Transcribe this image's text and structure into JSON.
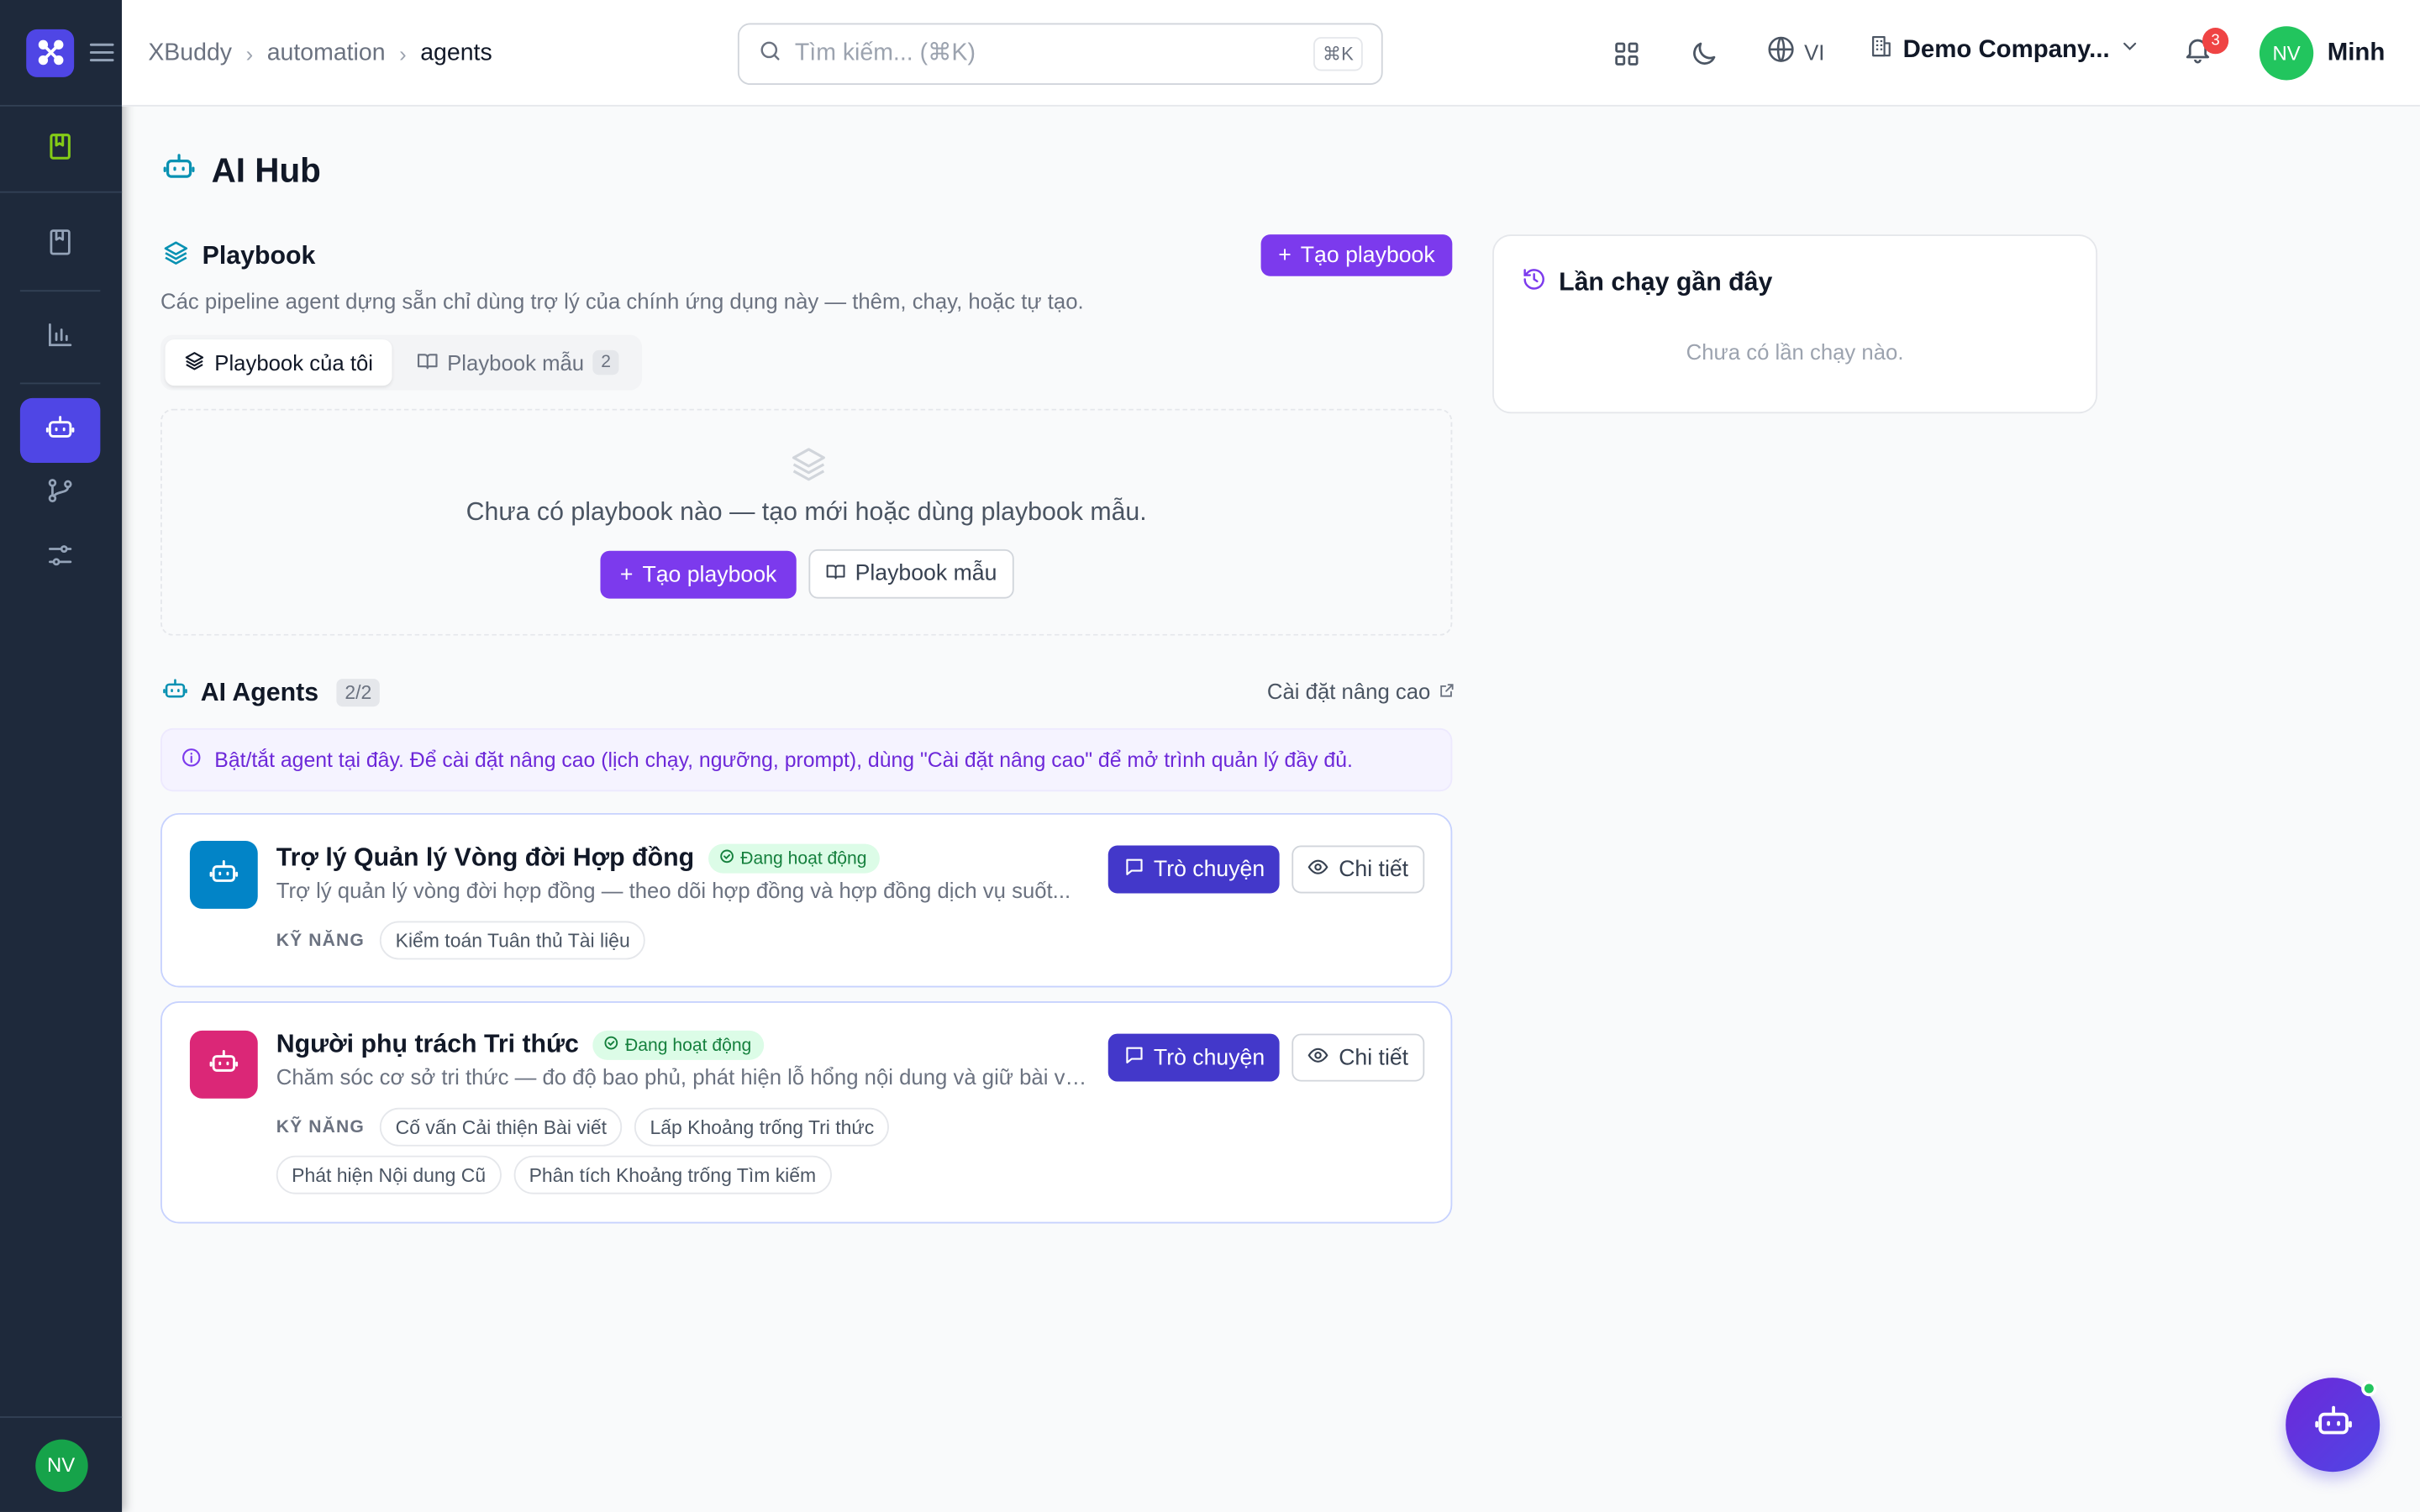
{
  "breadcrumb": [
    "XBuddy",
    "automation",
    "agents"
  ],
  "search": {
    "placeholder": "Tìm kiếm... (⌘K)",
    "shortcut": "⌘K"
  },
  "header": {
    "language": "VI",
    "company": "Demo Company...",
    "notifications": "3",
    "user_initials": "NV",
    "user_name": "Minh"
  },
  "sidebar": {
    "user_initials": "NV"
  },
  "page": {
    "title": "AI Hub"
  },
  "playbook": {
    "title": "Playbook",
    "create_button": "Tạo playbook",
    "description": "Các pipeline agent dựng sẵn chỉ dùng trợ lý của chính ứng dụng này — thêm, chạy, hoặc tự tạo.",
    "tabs": [
      {
        "label": "Playbook của tôi"
      },
      {
        "label": "Playbook mẫu",
        "count": "2"
      }
    ],
    "empty_text": "Chưa có playbook nào — tạo mới hoặc dùng playbook mẫu.",
    "empty_create": "Tạo playbook",
    "empty_templates": "Playbook mẫu"
  },
  "agents": {
    "title": "AI Agents",
    "count": "2/2",
    "advanced_link": "Cài đặt nâng cao",
    "info": "Bật/tắt agent tại đây. Để cài đặt nâng cao (lịch chạy, ngưỡng, prompt), dùng \"Cài đặt nâng cao\" để mở trình quản lý đầy đủ.",
    "skills_label": "KỸ NĂNG",
    "chat_button": "Trò chuyện",
    "detail_button": "Chi tiết",
    "items": [
      {
        "name": "Trợ lý Quản lý Vòng đời Hợp đồng",
        "status": "Đang hoạt động",
        "description": "Trợ lý quản lý vòng đời hợp đồng — theo dõi hợp đồng và hợp đồng dịch vụ suốt...",
        "skills": [
          "Kiểm toán Tuân thủ Tài liệu"
        ],
        "color": "#0284c7"
      },
      {
        "name": "Người phụ trách Tri thức",
        "status": "Đang hoạt động",
        "description": "Chăm sóc cơ sở tri thức — đo độ bao phủ, phát hiện lỗ hổng nội dung và giữ bài viế...",
        "skills": [
          "Cố vấn Cải thiện Bài viết",
          "Lấp Khoảng trống Tri thức",
          "Phát hiện Nội dung Cũ",
          "Phân tích Khoảng trống Tìm kiếm"
        ],
        "color": "#db2777"
      }
    ]
  },
  "recent_runs": {
    "title": "Lần chạy gần đây",
    "empty": "Chưa có lần chạy nào."
  },
  "colors": {
    "accent": "#7c3aed",
    "indigo": "#4338ca",
    "sidebar": "#1e293b",
    "success": "#16a34a"
  }
}
